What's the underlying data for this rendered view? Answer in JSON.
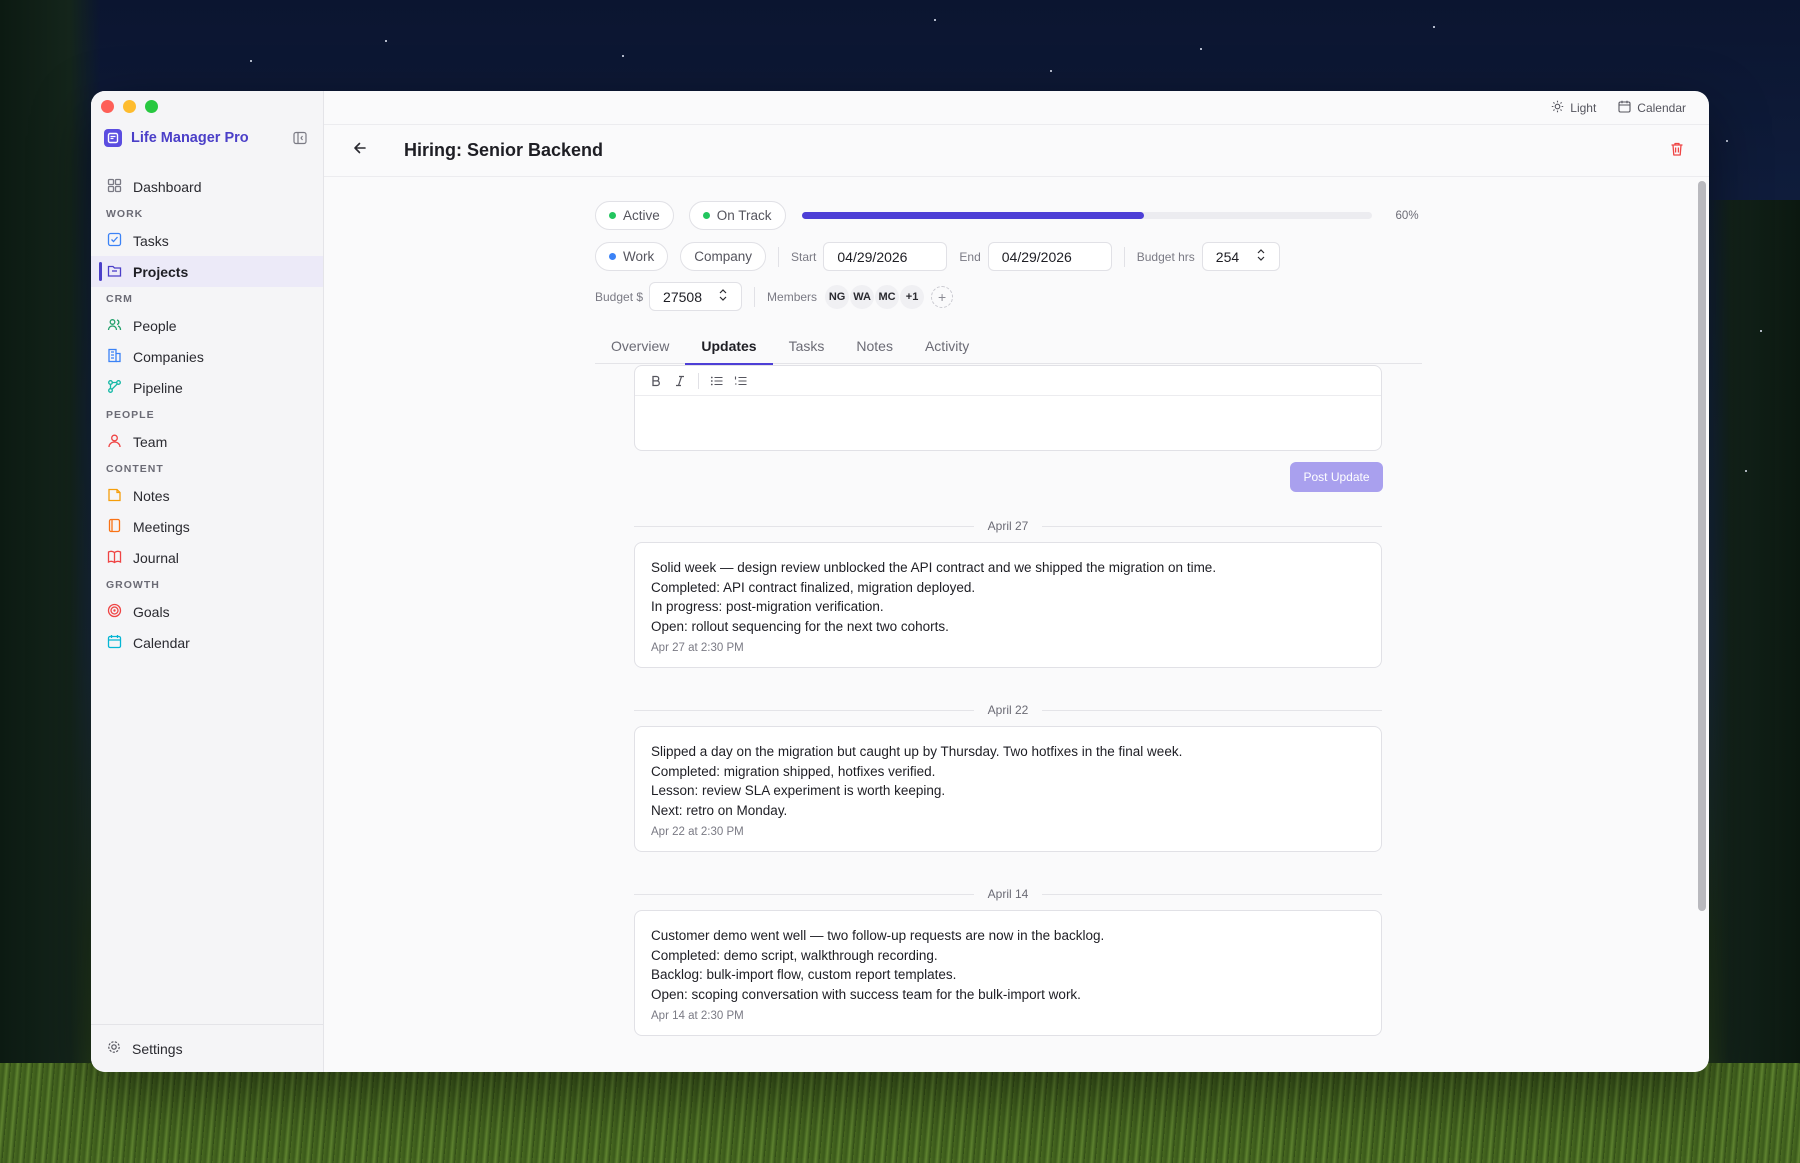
{
  "app": {
    "name": "Life Manager Pro"
  },
  "sidebar": {
    "items": [
      {
        "type": "item",
        "label": "Dashboard",
        "icon": "dashboard-icon",
        "color": "#7a7a84"
      },
      {
        "type": "section",
        "label": "WORK"
      },
      {
        "type": "item",
        "label": "Tasks",
        "icon": "checkbox-icon",
        "color": "#3b82f6"
      },
      {
        "type": "item",
        "label": "Projects",
        "icon": "folder-icon",
        "color": "#4b3fc8",
        "active": true
      },
      {
        "type": "section",
        "label": "CRM"
      },
      {
        "type": "item",
        "label": "People",
        "icon": "users-icon",
        "color": "#22a06b"
      },
      {
        "type": "item",
        "label": "Companies",
        "icon": "building-icon",
        "color": "#3b82f6"
      },
      {
        "type": "item",
        "label": "Pipeline",
        "icon": "pipeline-icon",
        "color": "#14b8a6"
      },
      {
        "type": "section",
        "label": "PEOPLE"
      },
      {
        "type": "item",
        "label": "Team",
        "icon": "team-icon",
        "color": "#ef4444"
      },
      {
        "type": "section",
        "label": "CONTENT"
      },
      {
        "type": "item",
        "label": "Notes",
        "icon": "note-icon",
        "color": "#f59e0b"
      },
      {
        "type": "item",
        "label": "Meetings",
        "icon": "book-icon",
        "color": "#f97316"
      },
      {
        "type": "item",
        "label": "Journal",
        "icon": "journal-icon",
        "color": "#ef4444"
      },
      {
        "type": "section",
        "label": "GROWTH"
      },
      {
        "type": "item",
        "label": "Goals",
        "icon": "target-icon",
        "color": "#ef4444"
      },
      {
        "type": "item",
        "label": "Calendar",
        "icon": "calendar-icon",
        "color": "#06b6d4"
      }
    ],
    "settings_label": "Settings"
  },
  "topbar": {
    "theme_label": "Light",
    "calendar_label": "Calendar"
  },
  "project": {
    "title": "Hiring: Senior Backend",
    "status": "Active",
    "status_color": "#22c55e",
    "health": "On Track",
    "health_color": "#22c55e",
    "progress_percent": 60,
    "progress_label": "60%",
    "area": "Work",
    "area_color": "#3b82f6",
    "company": "Company",
    "start_label": "Start",
    "start_date": "04/29/2026",
    "end_label": "End",
    "end_date": "04/29/2026",
    "budget_hrs_label": "Budget hrs",
    "budget_hrs": "254",
    "budget_label": "Budget $",
    "budget": "27508",
    "members_label": "Members",
    "members": [
      "NG",
      "WA",
      "MC",
      "+1"
    ],
    "add_member": "+"
  },
  "tabs": [
    "Overview",
    "Updates",
    "Tasks",
    "Notes",
    "Activity"
  ],
  "active_tab": "Updates",
  "editor": {
    "post_label": "Post Update"
  },
  "updates": [
    {
      "date_header": "April 27",
      "lines": [
        "Solid week — design review unblocked the API contract and we shipped the migration on time.",
        "Completed: API contract finalized, migration deployed.",
        "In progress: post-migration verification.",
        "Open: rollout sequencing for the next two cohorts."
      ],
      "timestamp": "Apr 27 at 2:30 PM"
    },
    {
      "date_header": "April 22",
      "lines": [
        "Slipped a day on the migration but caught up by Thursday. Two hotfixes in the final week.",
        "Completed: migration shipped, hotfixes verified.",
        "Lesson: review SLA experiment is worth keeping.",
        "Next: retro on Monday."
      ],
      "timestamp": "Apr 22 at 2:30 PM"
    },
    {
      "date_header": "April 14",
      "lines": [
        "Customer demo went well — two follow-up requests are now in the backlog.",
        "Completed: demo script, walkthrough recording.",
        "Backlog: bulk-import flow, custom report templates.",
        "Open: scoping conversation with success team for the bulk-import work."
      ],
      "timestamp": "Apr 14 at 2:30 PM"
    }
  ],
  "colors": {
    "accent": "#4d3fd6",
    "danger": "#ef4444"
  }
}
